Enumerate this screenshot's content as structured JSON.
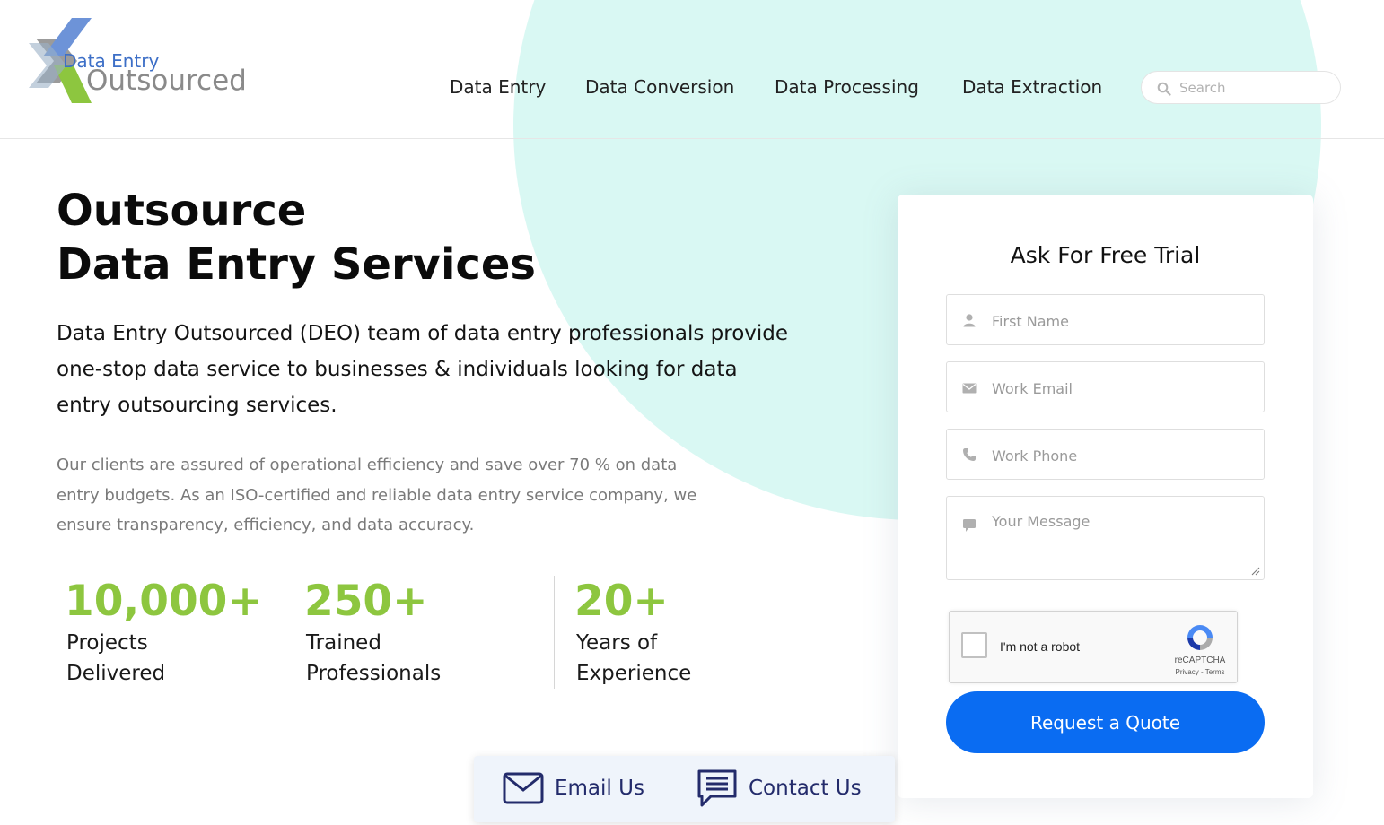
{
  "logo": {
    "line1": "Data Entry",
    "line2": "Outsourced"
  },
  "nav": {
    "items": [
      {
        "label": "Data Entry"
      },
      {
        "label": "Data Conversion"
      },
      {
        "label": "Data Processing"
      },
      {
        "label": "Data Extraction"
      }
    ],
    "search_placeholder": "Search"
  },
  "hero": {
    "title_line1": "Outsource",
    "title_line2": "Data Entry Services",
    "lead": "Data Entry Outsourced (DEO) team of data entry professionals provide one-stop data service to businesses & individuals looking for data entry outsourcing services.",
    "sub": "Our clients are assured of operational efficiency and save over 70 % on data entry budgets. As an ISO-certified and reliable data entry service company, we ensure transparency, efficiency, and data accuracy."
  },
  "stats": [
    {
      "number": "10,000+",
      "label": "Projects\nDelivered"
    },
    {
      "number": "250+",
      "label": "Trained\nProfessionals"
    },
    {
      "number": "20+",
      "label": "Years of\nExperience"
    }
  ],
  "form": {
    "title": "Ask For Free Trial",
    "first_name_placeholder": "First Name",
    "email_placeholder": "Work Email",
    "phone_placeholder": "Work Phone",
    "message_placeholder": "Your Message",
    "captcha_label": "I'm not a robot",
    "captcha_brand": "reCAPTCHA",
    "captcha_terms": "Privacy - Terms",
    "submit_label": "Request a Quote"
  },
  "contact_bar": {
    "email_label": "Email Us",
    "contact_label": "Contact Us"
  },
  "colors": {
    "accent_green": "#8dc63f",
    "button_blue": "#0a6cf2",
    "mint_background": "#d9f8f3",
    "contact_text": "#232b6b"
  }
}
